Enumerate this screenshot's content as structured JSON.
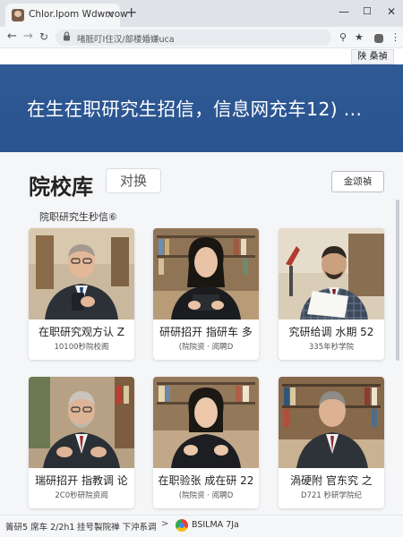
{
  "browser": {
    "tab_title": "Chlor.lpom Wdwrvow",
    "tab_close": "×",
    "new_tab": "+",
    "window_controls": {
      "minimize": "—",
      "maximize": "☐",
      "close": "✕"
    },
    "nav": {
      "back": "←",
      "forward": "→",
      "reload": "↻"
    },
    "lock_icon": "🔒",
    "url": "啫胝叮I住汉/部楼婚嫌uca",
    "icons": {
      "star": "★",
      "search": "⚲",
      "menu": "⋮"
    }
  },
  "page": {
    "lang_button": "陕 桑禎",
    "banner_title": "在生在职研究生招信，信息网充车12) ...",
    "section_title": "院校库",
    "switch_button": "对换",
    "all_button": "金颂禎",
    "subheading": "院职研究生秒信⑥",
    "cards": [
      {
        "title": "在职研究观方认 Z",
        "meta": "10100秒院校阁",
        "photo": "man-glasses-phone"
      },
      {
        "title": "研研招开 指研车 多",
        "meta": "(院院资 · 阅聘D",
        "photo": "woman-tablet"
      },
      {
        "title": "究研给调 水期 52",
        "meta": "335年秒学院",
        "photo": "man-document"
      },
      {
        "title": "瑞研招开 指教调 论",
        "meta": "2C0秒研院资阅",
        "photo": "man-glasses-gesture"
      },
      {
        "title": "在职验张 成在研 22",
        "meta": "(院院资 · 阅聘D",
        "photo": "woman-gesture"
      },
      {
        "title": "渦硬附 官东究 之",
        "meta": "D721 秒研学院纪",
        "photo": "man-library"
      }
    ],
    "footer": {
      "left": "箐研5 席车 2/2h1",
      "middle": "挂号製院禅 下沖系调",
      "separator": ">",
      "right": "BSILMA 7Ja"
    }
  },
  "colors": {
    "banner": "#2f5a93",
    "page_bg": "#f5f6f8",
    "chrome_bg": "#dfe3e8"
  }
}
